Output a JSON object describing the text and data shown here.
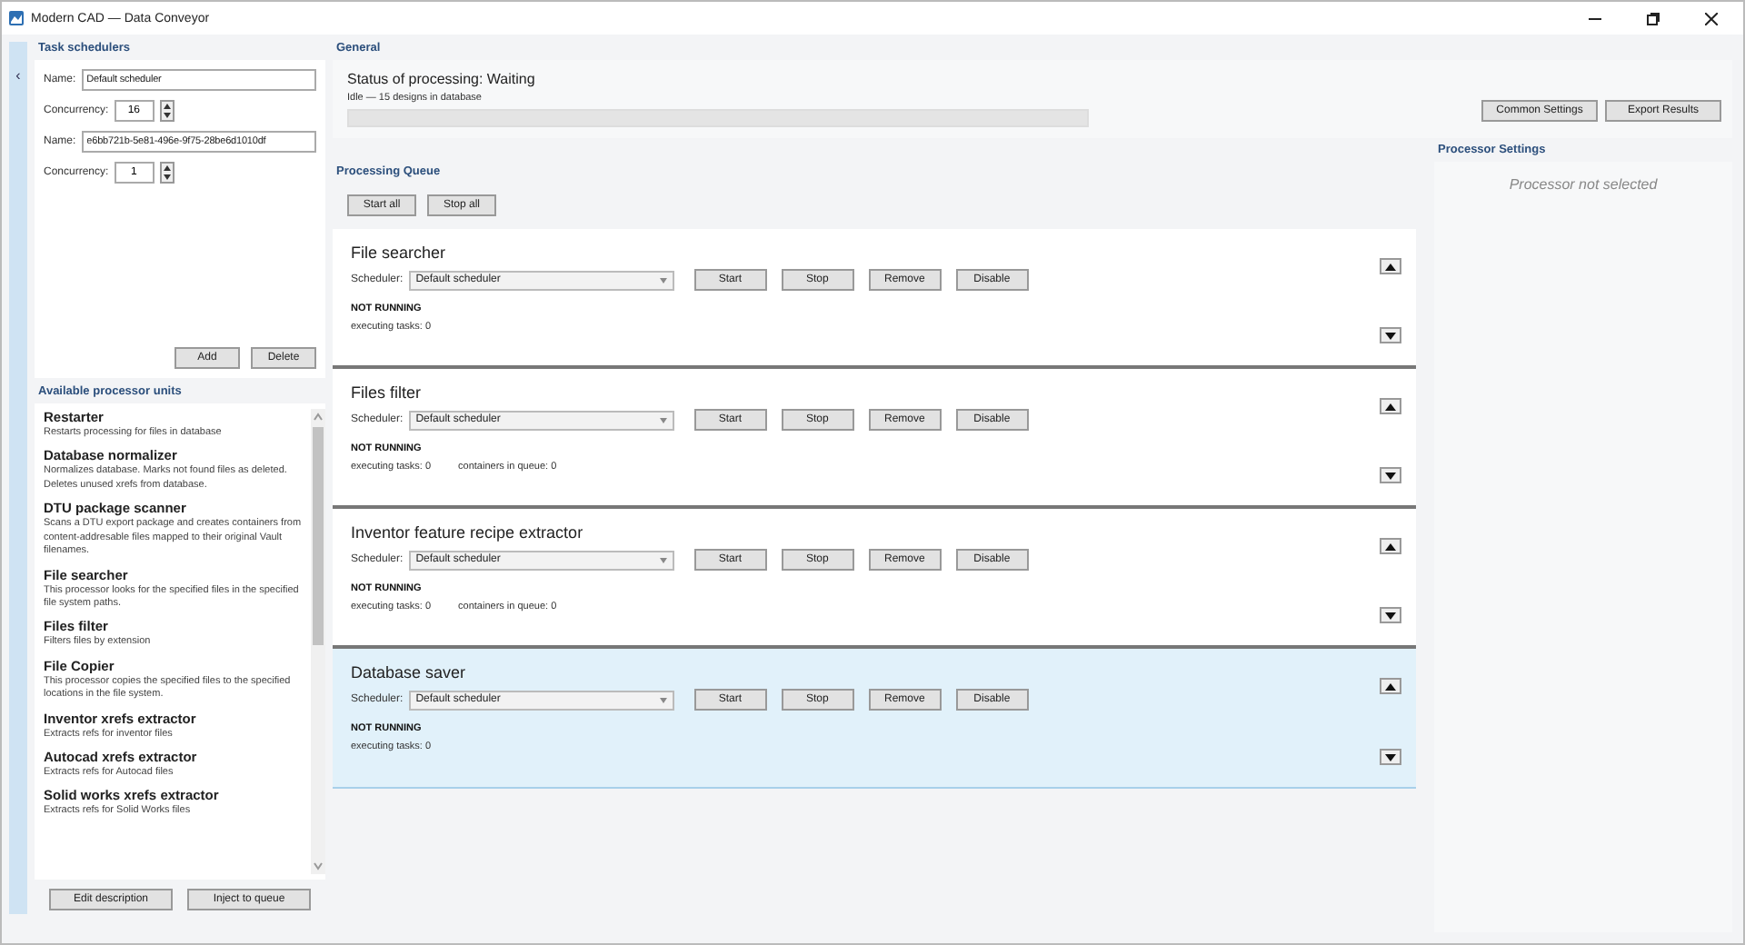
{
  "window": {
    "title": "Modern CAD — Data Conveyor"
  },
  "sidebar_toggle": "‹",
  "task_schedulers": {
    "title": "Task schedulers",
    "schedulers": [
      {
        "name_label": "Name:",
        "name": "Default scheduler",
        "concurrency_label": "Concurrency:",
        "concurrency": "16"
      },
      {
        "name_label": "Name:",
        "name": "e6bb721b-5e81-496e-9f75-28be6d1010df",
        "concurrency_label": "Concurrency:",
        "concurrency": "1"
      }
    ],
    "buttons": [
      "Add",
      "Delete"
    ]
  },
  "processor_units": {
    "title": "Available processor units",
    "items": [
      {
        "name": "Restarter",
        "description": "Restarts processing for files in database"
      },
      {
        "name": "Database normalizer",
        "description": "Normalizes database. Marks not found files as deleted. Deletes unused xrefs from database."
      },
      {
        "name": "DTU package scanner",
        "description": "Scans a DTU export package and creates containers from content-addresable files mapped to their original Vault filenames."
      },
      {
        "name": "File searcher",
        "description": "This processor looks for the specified files in the specified file system paths."
      },
      {
        "name": "Files filter",
        "description": "Filters files by extension"
      },
      {
        "name": "File Copier",
        "description": "This processor copies the specified files to the specified locations in the file system."
      },
      {
        "name": "Inventor xrefs extractor",
        "description": "Extracts refs for inventor files"
      },
      {
        "name": "Autocad xrefs extractor",
        "description": "Extracts refs for Autocad files"
      },
      {
        "name": "Solid works xrefs extractor",
        "description": "Extracts refs for Solid Works files"
      }
    ],
    "buttons": [
      "Edit description",
      "Inject to queue"
    ]
  },
  "general": {
    "title": "General",
    "status": "Status of processing: Waiting",
    "detail": "Idle — 15 designs in database",
    "level": 0,
    "buttons": [
      "Common Settings",
      "Export Results"
    ]
  },
  "queue": {
    "title": "Processing Queue",
    "buttons": [
      "Start all",
      "Stop all"
    ],
    "processors": [
      {
        "name": "File searcher",
        "selected": false,
        "scheduler_label": "Scheduler:",
        "scheduler": "Default scheduler",
        "actions": [
          "Start",
          "Stop",
          "Remove",
          "Disable"
        ],
        "state": "NOT RUNNING",
        "stats": [
          "executing tasks: 0"
        ]
      },
      {
        "name": "Files filter",
        "selected": false,
        "scheduler_label": "Scheduler:",
        "scheduler": "Default scheduler",
        "actions": [
          "Start",
          "Stop",
          "Remove",
          "Disable"
        ],
        "state": "NOT RUNNING",
        "stats": [
          "executing tasks: 0",
          "containers in queue: 0"
        ]
      },
      {
        "name": "Inventor feature recipe extractor",
        "selected": false,
        "scheduler_label": "Scheduler:",
        "scheduler": "Default scheduler",
        "actions": [
          "Start",
          "Stop",
          "Remove",
          "Disable"
        ],
        "state": "NOT RUNNING",
        "stats": [
          "executing tasks: 0",
          "containers in queue: 0"
        ]
      },
      {
        "name": "Database saver",
        "selected": true,
        "scheduler_label": "Scheduler:",
        "scheduler": "Default scheduler",
        "actions": [
          "Start",
          "Stop",
          "Remove",
          "Disable"
        ],
        "state": "NOT RUNNING",
        "stats": [
          "executing tasks: 0"
        ]
      }
    ]
  },
  "processor_settings": {
    "title": "Processor Settings",
    "message": "Processor not selected"
  }
}
